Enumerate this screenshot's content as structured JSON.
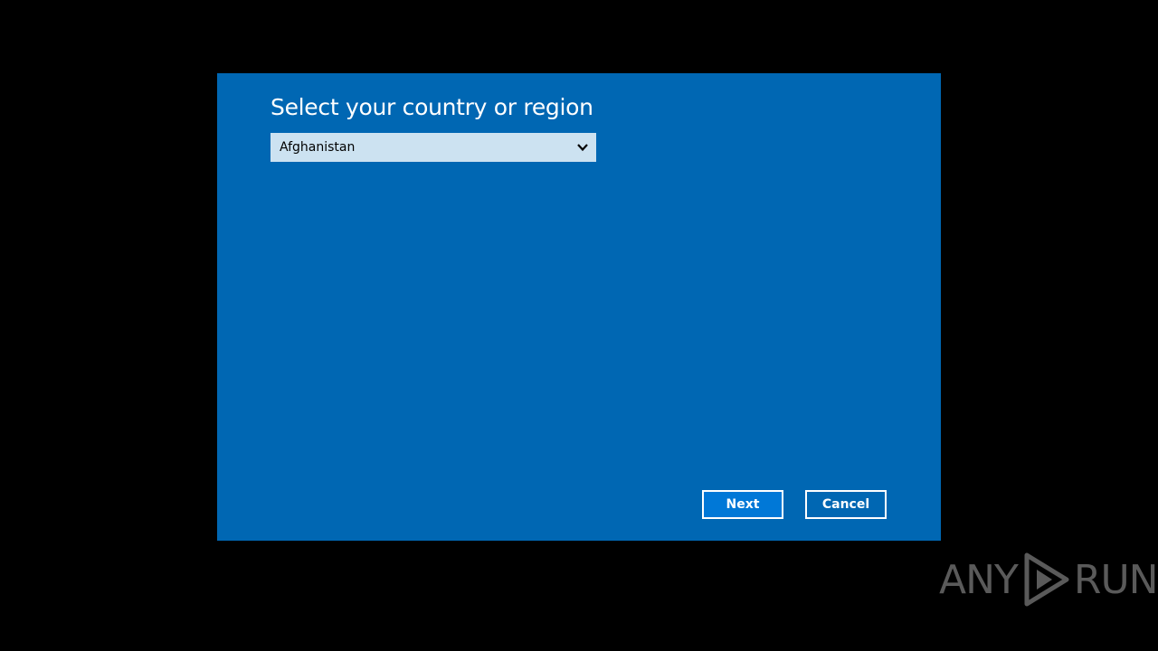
{
  "dialog": {
    "title": "Select your country or region",
    "country_select": {
      "value": "Afghanistan"
    },
    "buttons": {
      "next_label": "Next",
      "cancel_label": "Cancel"
    }
  },
  "watermark": {
    "left_text": "ANY",
    "right_text": "RUN"
  },
  "colors": {
    "background": "#000000",
    "dialog_blue": "#0067B3",
    "select_fill": "#CCE2F1",
    "button_border": "#FFFFFF",
    "watermark_gray": "#5A5A5A"
  },
  "icons": {
    "select_arrow": "chevron-down-icon",
    "watermark_logo": "play-triangle-logo"
  }
}
